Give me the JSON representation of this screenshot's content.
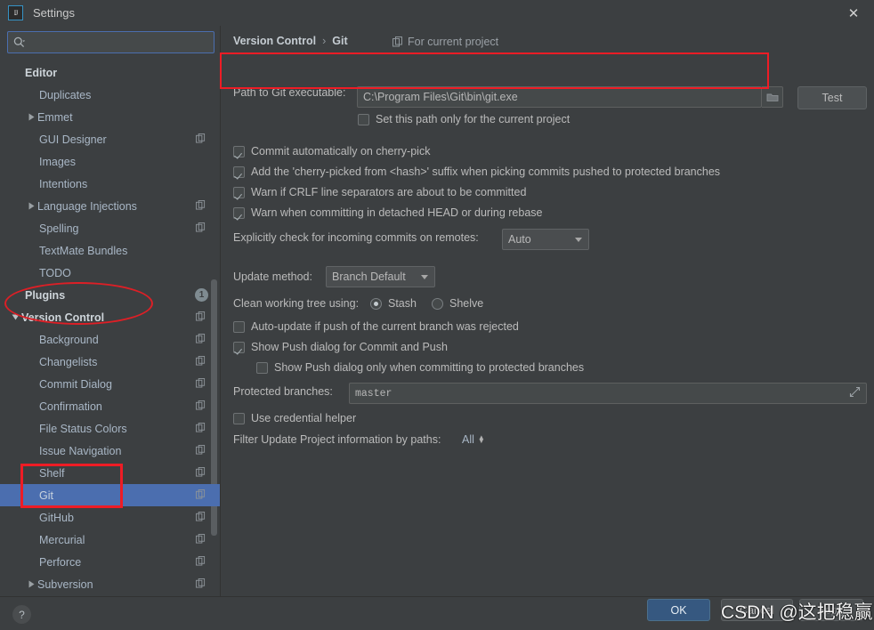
{
  "window": {
    "title": "Settings",
    "logo_text": "IJ",
    "close_icon": "✕"
  },
  "search": {
    "value": "",
    "placeholder": "",
    "icon": "search-icon"
  },
  "sidebar": {
    "scrollbar": true,
    "items": [
      {
        "label": "Editor",
        "indent": 0,
        "bold": true,
        "arrow": "",
        "copy": false,
        "badge": "",
        "selected": false
      },
      {
        "label": "Duplicates",
        "indent": 1,
        "bold": false,
        "arrow": "",
        "copy": false,
        "badge": "",
        "selected": false
      },
      {
        "label": "Emmet",
        "indent": 1,
        "bold": false,
        "arrow": "right",
        "copy": false,
        "badge": "",
        "selected": false
      },
      {
        "label": "GUI Designer",
        "indent": 1,
        "bold": false,
        "arrow": "",
        "copy": true,
        "badge": "",
        "selected": false
      },
      {
        "label": "Images",
        "indent": 1,
        "bold": false,
        "arrow": "",
        "copy": false,
        "badge": "",
        "selected": false
      },
      {
        "label": "Intentions",
        "indent": 1,
        "bold": false,
        "arrow": "",
        "copy": false,
        "badge": "",
        "selected": false
      },
      {
        "label": "Language Injections",
        "indent": 1,
        "bold": false,
        "arrow": "right",
        "copy": true,
        "badge": "",
        "selected": false
      },
      {
        "label": "Spelling",
        "indent": 1,
        "bold": false,
        "arrow": "",
        "copy": true,
        "badge": "",
        "selected": false
      },
      {
        "label": "TextMate Bundles",
        "indent": 1,
        "bold": false,
        "arrow": "",
        "copy": false,
        "badge": "",
        "selected": false
      },
      {
        "label": "TODO",
        "indent": 1,
        "bold": false,
        "arrow": "",
        "copy": false,
        "badge": "",
        "selected": false
      },
      {
        "label": "Plugins",
        "indent": 0,
        "bold": true,
        "arrow": "",
        "copy": false,
        "badge": "1",
        "selected": false
      },
      {
        "label": "Version Control",
        "indent": 0,
        "bold": true,
        "arrow": "down",
        "copy": true,
        "badge": "",
        "selected": false
      },
      {
        "label": "Background",
        "indent": 1,
        "bold": false,
        "arrow": "",
        "copy": true,
        "badge": "",
        "selected": false
      },
      {
        "label": "Changelists",
        "indent": 1,
        "bold": false,
        "arrow": "",
        "copy": true,
        "badge": "",
        "selected": false
      },
      {
        "label": "Commit Dialog",
        "indent": 1,
        "bold": false,
        "arrow": "",
        "copy": true,
        "badge": "",
        "selected": false
      },
      {
        "label": "Confirmation",
        "indent": 1,
        "bold": false,
        "arrow": "",
        "copy": true,
        "badge": "",
        "selected": false
      },
      {
        "label": "File Status Colors",
        "indent": 1,
        "bold": false,
        "arrow": "",
        "copy": true,
        "badge": "",
        "selected": false
      },
      {
        "label": "Issue Navigation",
        "indent": 1,
        "bold": false,
        "arrow": "",
        "copy": true,
        "badge": "",
        "selected": false
      },
      {
        "label": "Shelf",
        "indent": 1,
        "bold": false,
        "arrow": "",
        "copy": true,
        "badge": "",
        "selected": false
      },
      {
        "label": "Git",
        "indent": 1,
        "bold": false,
        "arrow": "",
        "copy": true,
        "badge": "",
        "selected": true
      },
      {
        "label": "GitHub",
        "indent": 1,
        "bold": false,
        "arrow": "",
        "copy": true,
        "badge": "",
        "selected": false
      },
      {
        "label": "Mercurial",
        "indent": 1,
        "bold": false,
        "arrow": "",
        "copy": true,
        "badge": "",
        "selected": false
      },
      {
        "label": "Perforce",
        "indent": 1,
        "bold": false,
        "arrow": "",
        "copy": true,
        "badge": "",
        "selected": false
      },
      {
        "label": "Subversion",
        "indent": 1,
        "bold": false,
        "arrow": "right",
        "copy": true,
        "badge": "",
        "selected": false
      }
    ]
  },
  "main": {
    "breadcrumb": {
      "parent": "Version Control",
      "separator": "›",
      "current": "Git"
    },
    "for_current_project": {
      "label": "For current project",
      "icon": "copy-scope-icon"
    },
    "git_path": {
      "label": "Path to Git executable:",
      "value": "C:\\Program Files\\Git\\bin\\git.exe",
      "browse_icon": "folder-icon",
      "test_button": "Test"
    },
    "set_path_only_current": {
      "label": "Set this path only for the current project",
      "checked": false
    },
    "checkboxes": [
      {
        "label": "Commit automatically on cherry-pick",
        "checked": true
      },
      {
        "label": "Add the 'cherry-picked from <hash>' suffix when picking commits pushed to protected branches",
        "checked": true
      },
      {
        "label": "Warn if CRLF line separators are about to be committed",
        "checked": true
      },
      {
        "label": "Warn when committing in detached HEAD or during rebase",
        "checked": true
      }
    ],
    "incoming_commits": {
      "label": "Explicitly check for incoming commits on remotes:",
      "value": "Auto"
    },
    "update_method": {
      "label": "Update method:",
      "value": "Branch Default"
    },
    "clean_working_tree": {
      "label": "Clean working tree using:",
      "options": [
        {
          "label": "Stash",
          "selected": true
        },
        {
          "label": "Shelve",
          "selected": false
        }
      ]
    },
    "auto_update": {
      "label": "Auto-update if push of the current branch was rejected",
      "checked": false
    },
    "show_push_dialog": {
      "label": "Show Push dialog for Commit and Push",
      "checked": true
    },
    "show_push_protected": {
      "label": "Show Push dialog only when committing to protected branches",
      "checked": false
    },
    "protected_branches": {
      "label": "Protected branches:",
      "value": "master",
      "expand_icon": "expand-diagonal-icon"
    },
    "use_credential_helper": {
      "label": "Use credential helper",
      "checked": false
    },
    "filter_update": {
      "label": "Filter Update Project information by paths:",
      "value": "All"
    }
  },
  "bottom": {
    "help_icon": "?",
    "ok": "OK",
    "cancel": "Cancel",
    "apply": "Apply"
  },
  "watermark": {
    "text": "CSDN @这把稳赢"
  },
  "colors": {
    "accent_selection": "#4b6eaf",
    "primary_button": "#365880",
    "annotation_red": "#ee1c25",
    "window_bg": "#3c3f41",
    "field_bg": "#45494a"
  }
}
